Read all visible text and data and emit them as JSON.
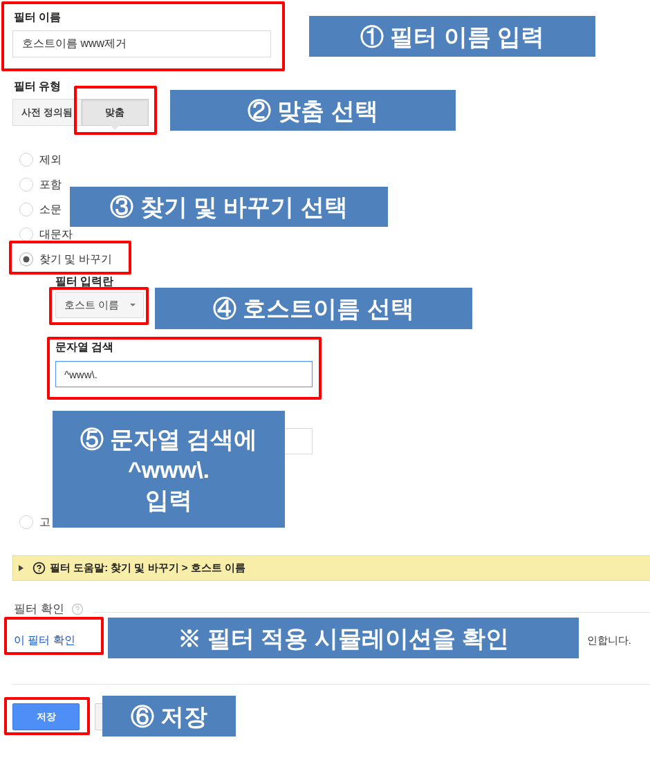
{
  "filter_name": {
    "label": "필터 이름",
    "value": "호스트이름 www제거"
  },
  "filter_type": {
    "label": "필터 유형",
    "options": [
      {
        "label": "사전 정의됨",
        "selected": false
      },
      {
        "label": "맞춤",
        "selected": true
      }
    ]
  },
  "custom_filters": [
    {
      "label": "제외",
      "selected": false
    },
    {
      "label": "포함",
      "selected": false
    },
    {
      "label": "소문",
      "selected": false
    },
    {
      "label": "대문자",
      "selected": false
    },
    {
      "label": "찾기 및 바꾸기",
      "selected": true,
      "settings": {
        "field_label": "필터 입력란",
        "field": "호스트 이름",
        "search_label": "문자열 검색",
        "search_value": "^www\\.",
        "search_focused": true
      }
    },
    {
      "label": "고",
      "selected": false
    }
  ],
  "help_bar": {
    "expanded": false,
    "text": "필터 도움말: 찾기 및 바꾸기 > 호스트 이름"
  },
  "verify": {
    "title": "필터 확인",
    "link": "이 필터 확인",
    "description": "인합니다."
  },
  "actions": [
    {
      "kind": "primary",
      "label": "저장"
    },
    {
      "kind": "secondary"
    }
  ],
  "callouts": [
    {
      "lines": [
        "① 필터 이름 입력"
      ]
    },
    {
      "lines": [
        "② 맞춤 선택"
      ]
    },
    {
      "lines": [
        "③ 찾기 및 바꾸기 선택"
      ]
    },
    {
      "lines": [
        "④ 호스트이름 선택"
      ]
    },
    {
      "lines": [
        "⑤ 문자열 검색에",
        "^www\\.",
        "입력"
      ]
    },
    {
      "lines": [
        "※ 필터 적용 시뮬레이션을 확인"
      ]
    },
    {
      "lines": [
        "⑥ 저장"
      ]
    }
  ]
}
